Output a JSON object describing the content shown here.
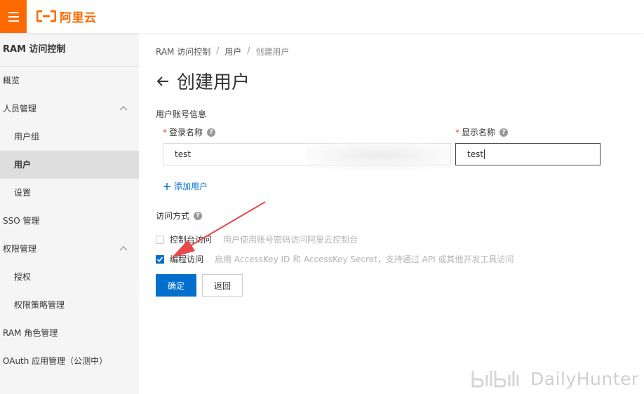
{
  "topbar": {
    "logo_text": "阿里云",
    "menu_icon": "hamburger-icon"
  },
  "sidebar": {
    "title": "RAM 访问控制",
    "items": [
      {
        "label": "概览"
      },
      {
        "label": "人员管理"
      },
      {
        "label": "用户组"
      },
      {
        "label": "用户"
      },
      {
        "label": "设置"
      },
      {
        "label": "SSO 管理"
      },
      {
        "label": "权限管理"
      },
      {
        "label": "授权"
      },
      {
        "label": "权限策略管理"
      },
      {
        "label": "RAM 角色管理"
      },
      {
        "label": "OAuth 应用管理（公测中）"
      }
    ]
  },
  "breadcrumb": {
    "items": [
      "RAM 访问控制",
      "用户",
      "创建用户"
    ],
    "separator": "/"
  },
  "page": {
    "title": "创建用户"
  },
  "form": {
    "section_account": "用户账号信息",
    "login_name_label": "登录名称",
    "display_name_label": "显示名称",
    "required_mark": "*",
    "help_mark": "?",
    "login_name_value": "test",
    "display_name_value": "test",
    "add_user_label": "添加用户",
    "section_access": "访问方式",
    "console_access_label": "控制台访问",
    "console_access_desc": "用户使用账号密码访问阿里云控制台",
    "console_access_checked": false,
    "api_access_label": "编程访问",
    "api_access_desc": "启用 AccessKey ID 和 AccessKey Secret，支持通过 API 或其他开发工具访问",
    "api_access_checked": true,
    "confirm_label": "确定",
    "back_label": "返回"
  },
  "watermark": {
    "text": "DailyHunter"
  },
  "colors": {
    "brand": "#ff6a00",
    "primary": "#0070cc",
    "annotation": "#e5484d"
  }
}
